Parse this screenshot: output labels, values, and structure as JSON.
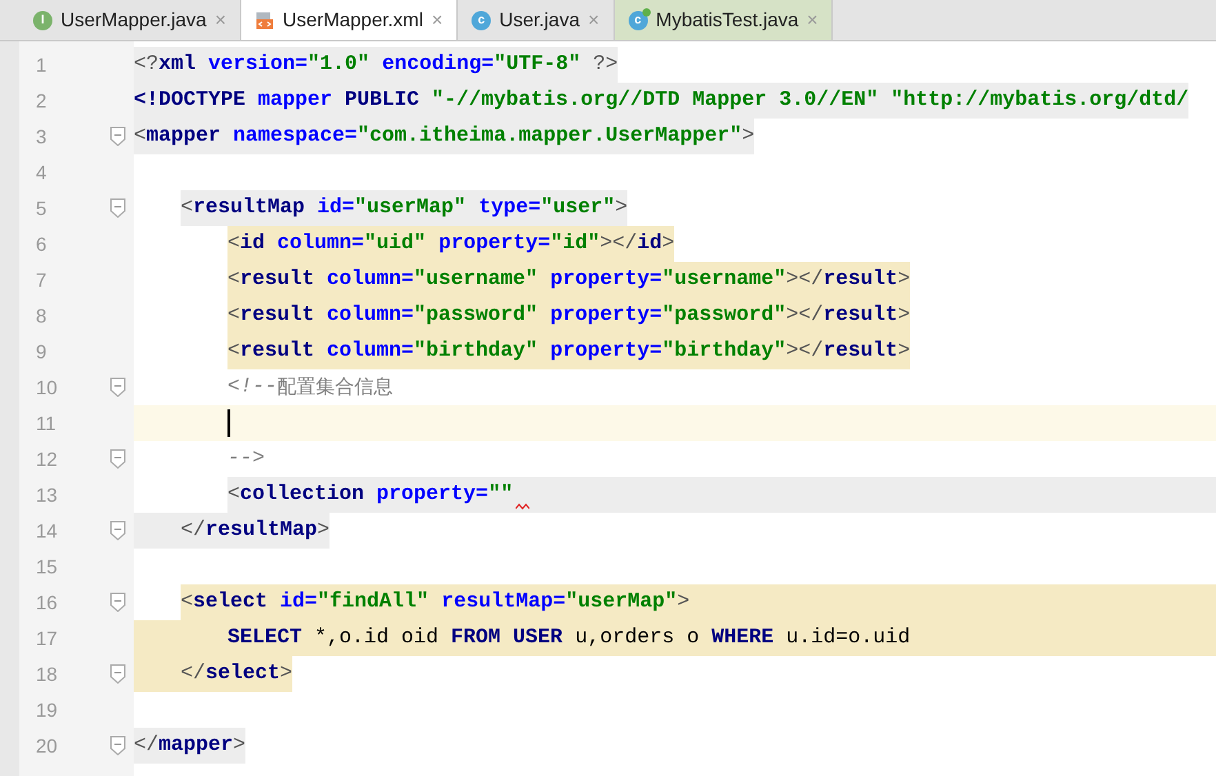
{
  "tabs": [
    {
      "label": "UserMapper.java",
      "kind": "interface",
      "icon_letter": "I",
      "selected": false,
      "close": "×"
    },
    {
      "label": "UserMapper.xml",
      "kind": "xml",
      "selected": true,
      "close": "×"
    },
    {
      "label": "User.java",
      "kind": "class",
      "icon_letter": "c",
      "selected": false,
      "close": "×"
    },
    {
      "label": "MybatisTest.java",
      "kind": "test",
      "icon_letter": "c",
      "selected": false,
      "close": "×"
    }
  ],
  "lines": [
    {
      "number": "1",
      "fold": false,
      "highlight": {
        "color": "#ededed",
        "kind": "inline"
      },
      "tokens": [
        {
          "kind": "punct",
          "text": "<?"
        },
        {
          "kind": "tag",
          "text": "xml "
        },
        {
          "kind": "attr",
          "text": "version="
        },
        {
          "kind": "value",
          "text": "\"1.0\" "
        },
        {
          "kind": "attr",
          "text": "encoding="
        },
        {
          "kind": "value",
          "text": "\"UTF-8\" "
        },
        {
          "kind": "punct",
          "text": "?>"
        }
      ]
    },
    {
      "number": "2",
      "fold": false,
      "highlight": {
        "color": "#ededed",
        "kind": "inline"
      },
      "tokens": [
        {
          "kind": "tag",
          "text": "<!DOCTYPE "
        },
        {
          "kind": "attr",
          "text": "mapper "
        },
        {
          "kind": "tag",
          "text": "PUBLIC "
        },
        {
          "kind": "value",
          "text": "\"-//mybatis.org//DTD Mapper 3.0//EN\" \"http://mybatis.org/dtd/"
        }
      ]
    },
    {
      "number": "3",
      "fold": true,
      "highlight": {
        "color": "#ededed",
        "kind": "inline"
      },
      "tokens": [
        {
          "kind": "punct",
          "text": "<"
        },
        {
          "kind": "tag",
          "text": "mapper "
        },
        {
          "kind": "attr",
          "text": "namespace="
        },
        {
          "kind": "value",
          "text": "\"com.itheima.mapper.UserMapper\""
        },
        {
          "kind": "punct",
          "text": ">"
        }
      ]
    },
    {
      "number": "4",
      "fold": false
    },
    {
      "number": "5",
      "fold": true,
      "kind": "inner",
      "highlight": {
        "color": "#ededed",
        "kind": "inline"
      },
      "tokens": [
        {
          "kind": "punct",
          "text": "<"
        },
        {
          "kind": "tag",
          "text": "resultMap "
        },
        {
          "kind": "attr",
          "text": "id="
        },
        {
          "kind": "value",
          "text": "\"userMap\" "
        },
        {
          "kind": "attr",
          "text": "type="
        },
        {
          "kind": "value",
          "text": "\"user\""
        },
        {
          "kind": "punct",
          "text": ">"
        }
      ]
    },
    {
      "number": "6",
      "fold": false,
      "kind": "deep",
      "highlight": {
        "color": "#f5eac4",
        "kind": "inline"
      },
      "tokens": [
        {
          "kind": "punct",
          "text": "<"
        },
        {
          "kind": "tag",
          "text": "id "
        },
        {
          "kind": "attr",
          "text": "column="
        },
        {
          "kind": "value",
          "text": "\"uid\" "
        },
        {
          "kind": "attr",
          "text": "property="
        },
        {
          "kind": "value",
          "text": "\"id\""
        },
        {
          "kind": "punct",
          "text": "></"
        },
        {
          "kind": "tag",
          "text": "id"
        },
        {
          "kind": "punct",
          "text": ">"
        }
      ]
    },
    {
      "number": "7",
      "fold": false,
      "kind": "deep",
      "highlight": {
        "color": "#f5eac4",
        "kind": "inline"
      },
      "tokens": [
        {
          "kind": "punct",
          "text": "<"
        },
        {
          "kind": "tag",
          "text": "result "
        },
        {
          "kind": "attr",
          "text": "column="
        },
        {
          "kind": "value",
          "text": "\"username\" "
        },
        {
          "kind": "attr",
          "text": "property="
        },
        {
          "kind": "value",
          "text": "\"username\""
        },
        {
          "kind": "punct",
          "text": "></"
        },
        {
          "kind": "tag",
          "text": "result"
        },
        {
          "kind": "punct",
          "text": ">"
        }
      ]
    },
    {
      "number": "8",
      "fold": false,
      "kind": "deep",
      "highlight": {
        "color": "#f5eac4",
        "kind": "inline"
      },
      "tokens": [
        {
          "kind": "punct",
          "text": "<"
        },
        {
          "kind": "tag",
          "text": "result "
        },
        {
          "kind": "attr",
          "text": "column="
        },
        {
          "kind": "value",
          "text": "\"password\" "
        },
        {
          "kind": "attr",
          "text": "property="
        },
        {
          "kind": "value",
          "text": "\"password\""
        },
        {
          "kind": "punct",
          "text": "></"
        },
        {
          "kind": "tag",
          "text": "result"
        },
        {
          "kind": "punct",
          "text": ">"
        }
      ]
    },
    {
      "number": "9",
      "fold": false,
      "kind": "deep",
      "highlight": {
        "color": "#f5eac4",
        "kind": "inline"
      },
      "tokens": [
        {
          "kind": "punct",
          "text": "<"
        },
        {
          "kind": "tag",
          "text": "result "
        },
        {
          "kind": "attr",
          "text": "column="
        },
        {
          "kind": "value",
          "text": "\"birthday\" "
        },
        {
          "kind": "attr",
          "text": "property="
        },
        {
          "kind": "value",
          "text": "\"birthday\""
        },
        {
          "kind": "punct",
          "text": "></"
        },
        {
          "kind": "tag",
          "text": "result"
        },
        {
          "kind": "punct",
          "text": ">"
        }
      ]
    },
    {
      "number": "10",
      "fold": true,
      "kind": "deep",
      "tokens": [
        {
          "kind": "comment",
          "text": "<!--"
        },
        {
          "kind": "cjk",
          "text": "配置集合信息"
        }
      ]
    },
    {
      "number": "11",
      "fold": false,
      "kind": "deep",
      "caret": true,
      "highlight": {
        "color": "#fdf9e8",
        "kind": "row"
      }
    },
    {
      "number": "12",
      "fold": true,
      "kind": "deep",
      "tokens": [
        {
          "kind": "comment",
          "text": "-->"
        }
      ]
    },
    {
      "number": "13",
      "fold": false,
      "kind": "deep",
      "error": true,
      "highlight": {
        "color": "#ededed",
        "kind": "trailing"
      },
      "tokens": [
        {
          "kind": "punct",
          "text": "<"
        },
        {
          "kind": "tag",
          "text": "collection "
        },
        {
          "kind": "attr",
          "text": "property="
        },
        {
          "kind": "value",
          "text": "\"\""
        }
      ]
    },
    {
      "number": "14",
      "fold": true,
      "kind": "inner",
      "highlight": {
        "color": "#ededed",
        "kind": "leading"
      },
      "tokens": [
        {
          "kind": "punct",
          "text": "</"
        },
        {
          "kind": "tag",
          "text": "resultMap"
        },
        {
          "kind": "punct",
          "text": ">"
        }
      ]
    },
    {
      "number": "15",
      "fold": false
    },
    {
      "number": "16",
      "fold": true,
      "kind": "inner",
      "highlight": {
        "color": "#f5eac4",
        "kind": "trailing"
      },
      "tokens": [
        {
          "kind": "punct",
          "text": "<"
        },
        {
          "kind": "tag",
          "text": "select "
        },
        {
          "kind": "attr",
          "text": "id="
        },
        {
          "kind": "value",
          "text": "\"findAll\" "
        },
        {
          "kind": "attr",
          "text": "resultMap="
        },
        {
          "kind": "value",
          "text": "\"userMap\""
        },
        {
          "kind": "punct",
          "text": ">"
        }
      ]
    },
    {
      "number": "17",
      "fold": false,
      "kind": "deep",
      "highlight": {
        "color": "#f5eac4",
        "kind": "row"
      },
      "tokens": [
        {
          "kind": "keyword",
          "text": "SELECT "
        },
        {
          "kind": "plain",
          "text": "*,o.id oid "
        },
        {
          "kind": "keyword",
          "text": "FROM USER "
        },
        {
          "kind": "plain",
          "text": "u,orders o "
        },
        {
          "kind": "keyword",
          "text": "WHERE "
        },
        {
          "kind": "plain",
          "text": "u.id=o.uid"
        }
      ]
    },
    {
      "number": "18",
      "fold": true,
      "kind": "inner",
      "highlight": {
        "color": "#f5eac4",
        "kind": "leading"
      },
      "tokens": [
        {
          "kind": "punct",
          "text": "</"
        },
        {
          "kind": "tag",
          "text": "select"
        },
        {
          "kind": "punct",
          "text": ">"
        }
      ]
    },
    {
      "number": "19",
      "fold": false
    },
    {
      "number": "20",
      "fold": true,
      "highlight": {
        "color": "#ededed",
        "kind": "inline"
      },
      "tokens": [
        {
          "kind": "punct",
          "text": "</"
        },
        {
          "kind": "tag",
          "text": "mapper"
        },
        {
          "kind": "punct",
          "text": ">"
        }
      ]
    }
  ]
}
